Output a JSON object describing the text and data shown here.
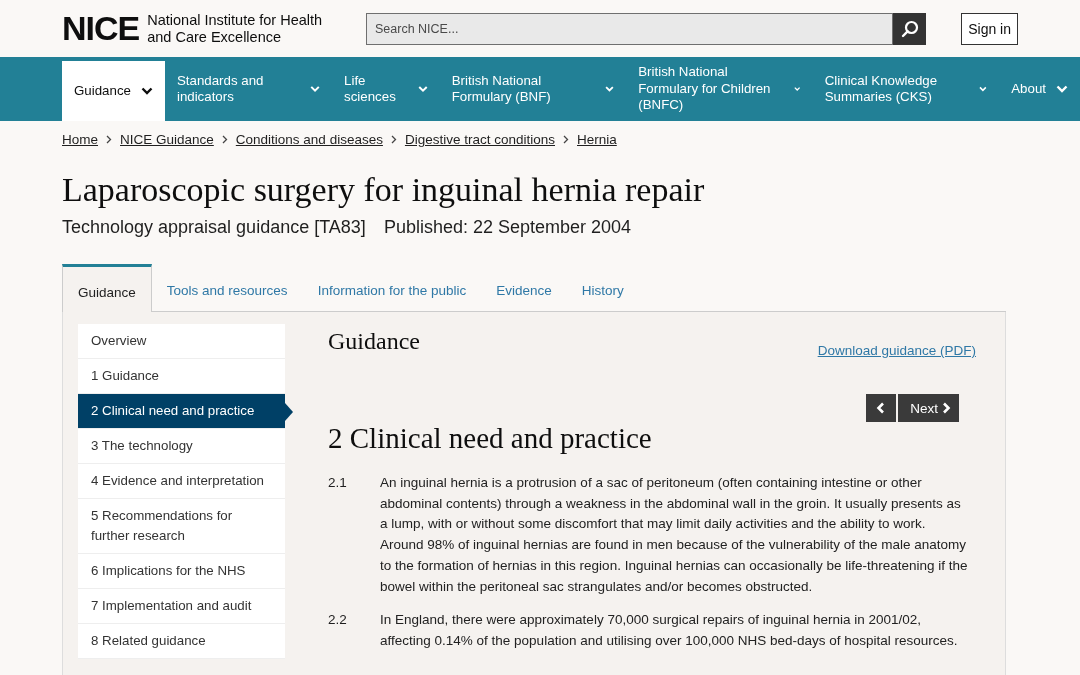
{
  "header": {
    "logo": "NICE",
    "org_name": "National Institute for Health and Care Excellence",
    "search": {
      "placeholder": "Search NICE..."
    },
    "sign_in": "Sign in"
  },
  "nav": [
    {
      "label": "Guidance",
      "selected": true
    },
    {
      "label": "Standards and indicators",
      "selected": false
    },
    {
      "label": "Life sciences",
      "selected": false
    },
    {
      "label": "British National Formulary (BNF)",
      "selected": false
    },
    {
      "label": "British National Formulary for Children (BNFC)",
      "selected": false
    },
    {
      "label": "Clinical Knowledge Summaries (CKS)",
      "selected": false
    },
    {
      "label": "About",
      "selected": false
    }
  ],
  "breadcrumbs": [
    "Home",
    "NICE Guidance",
    "Conditions and diseases",
    "Digestive tract conditions",
    "Hernia"
  ],
  "title": "Laparoscopic surgery for inguinal hernia repair",
  "subtitle": "Technology appraisal guidance [TA83]",
  "published": "Published: 22 September 2004",
  "tabs": [
    {
      "label": "Guidance",
      "selected": true
    },
    {
      "label": "Tools and resources",
      "selected": false
    },
    {
      "label": "Information for the public",
      "selected": false
    },
    {
      "label": "Evidence",
      "selected": false
    },
    {
      "label": "History",
      "selected": false
    }
  ],
  "sidebar": [
    {
      "label": "Overview",
      "selected": false
    },
    {
      "label": "1 Guidance",
      "selected": false
    },
    {
      "label": "2 Clinical need and practice",
      "selected": true
    },
    {
      "label": "3 The technology",
      "selected": false
    },
    {
      "label": "4 Evidence and interpretation",
      "selected": false
    },
    {
      "label": "5 Recommendations for further research",
      "selected": false
    },
    {
      "label": "6 Implications for the NHS",
      "selected": false
    },
    {
      "label": "7 Implementation and audit",
      "selected": false
    },
    {
      "label": "8 Related guidance",
      "selected": false
    }
  ],
  "content": {
    "heading": "Guidance",
    "download_link": "Download guidance (PDF)",
    "next_button": "Next",
    "section_title": "2 Clinical need and practice",
    "paragraphs": [
      {
        "number": "2.1",
        "text": "An inguinal hernia is a protrusion of a sac of peritoneum (often containing intestine or other abdominal contents) through a weakness in the abdominal wall in the groin. It usually presents as a lump, with or without some discomfort that may limit daily activities and the ability to work. Around 98% of inguinal hernias are found in men because of the vulnerability of the male anatomy to the formation of hernias in this region. Inguinal hernias can occasionally be life-threatening if the bowel within the peritoneal sac strangulates and/or becomes obstructed."
      },
      {
        "number": "2.2",
        "text": "In England, there were approximately 70,000 surgical repairs of inguinal hernia in 2001/02, affecting 0.14% of the population and utilising over 100,000 NHS bed-days of hospital resources."
      }
    ]
  }
}
